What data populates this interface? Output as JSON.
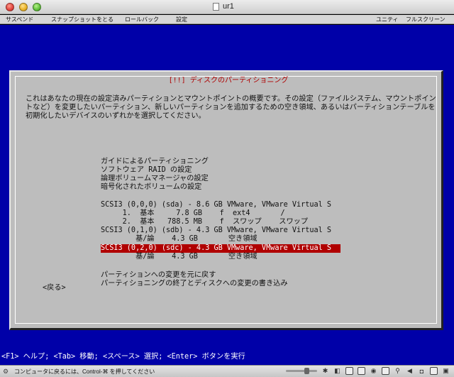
{
  "window": {
    "title": "ur1"
  },
  "toolbar": {
    "items": [
      "サスペンド",
      "スナップショットをとる",
      "ロールバック",
      "設定"
    ],
    "right_items": [
      "ユニティ",
      "フルスクリーン"
    ]
  },
  "dialog": {
    "title": "[!!] ディスクのパーティショニング",
    "intro": "これはあなたの現在の設定済みパーティションとマウントポイントの概要です。その設定（ファイルシステム、マウントポイントなど）を変更したいパーティション、新しいパーティションを追加するための空き領域、あるいはパーティションテーブルを初期化したいデバイスのいずれかを選択してください。",
    "menu": [
      "ガイドによるパーティショニング",
      "ソフトウェア RAID の設定",
      "論理ボリュームマネージャの設定",
      "暗号化されたボリュームの設定",
      "",
      "SCSI3 (0,0,0) (sda) - 8.6 GB VMware, VMware Virtual S",
      "     1.  基本     7.8 GB    f  ext4       /",
      "     2.  基本   788.5 MB    f  スワップ    スワップ",
      "SCSI3 (0,1,0) (sdb) - 4.3 GB VMware, VMware Virtual S",
      "        基/論    4.3 GB       空き領域",
      "SCSI3 (0,2,0) (sdc) - 4.3 GB VMware, VMware Virtual S",
      "        基/論    4.3 GB       空き領域",
      "",
      "パーティションへの変更を元に戻す",
      "パーティショニングの終了とディスクへの変更の書き込み"
    ],
    "selected_index": 10,
    "back_label": "<戻る>"
  },
  "help_line": "<F1> ヘルプ; <Tab> 移動; <スペース> 選択; <Enter> ボタンを実行",
  "status": {
    "text": "コンピュータに戻るには、Control-⌘ を押してください"
  },
  "colors": {
    "console_bg": "#0000a8",
    "dialog_bg": "#bdbdbd",
    "highlight": "#b00000"
  }
}
